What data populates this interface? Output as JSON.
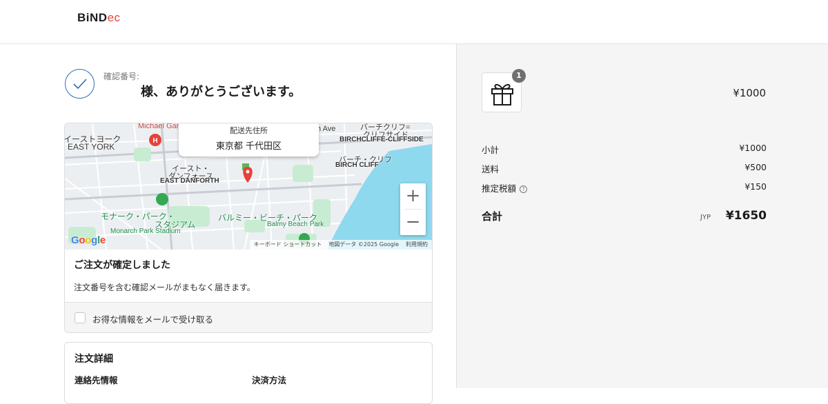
{
  "header": {
    "logo_main": "BiND",
    "logo_accent": "ec"
  },
  "confirmation": {
    "number_label": "確認番号:",
    "thanks": "様、ありがとうございます。"
  },
  "map": {
    "popup_label": "配送先住所",
    "popup_address": "東京都 千代田区",
    "zoom_in": "+",
    "zoom_out": "−",
    "google_logo": "Google",
    "labels": {
      "michael": "Michael Garro",
      "east_york_jp": "イーストヨーク",
      "east_york_en": "EAST YORK",
      "ave": "n Ave",
      "birchcliffe_jp": "バーチクリフ=",
      "birchcliffe_jp2": "クリフサイド",
      "birchcliffe_en": "BIRCHCLIFFE-CLIFFSIDE",
      "birch_cliff_jp": "バーチ・クリフ",
      "birch_cliff_en": "BIRCH CLIFF",
      "east_danforth_jp": "イースト・",
      "east_danforth_jp2": "ダンフォース",
      "east_danforth_en": "EAST DANFORTH",
      "monarch_jp": "モナーク・パーク・",
      "monarch_jp2": "スタジアム",
      "monarch_en": "Monarch Park Stadium",
      "balmy_jp": "バルミー・ビーチ・パーク",
      "balmy_en": "Balmy Beach Park"
    },
    "attribution": {
      "shortcuts": "キーボード ショートカット",
      "data": "地図データ ©2025 Google",
      "terms": "利用規約"
    }
  },
  "order_confirmed": {
    "title": "ご注文が確定しました",
    "text": "注文番号を含む確認メールがまもなく届きます。",
    "optin_label": "お得な情報をメールで受け取る"
  },
  "order_details": {
    "title": "注文詳細",
    "contact_label": "連絡先情報",
    "payment_label": "決済方法"
  },
  "summary": {
    "item_qty": "1",
    "item_icon": "gift-icon",
    "item_price": "¥1000",
    "subtotal_label": "小計",
    "subtotal_value": "¥1000",
    "shipping_label": "送料",
    "shipping_value": "¥500",
    "tax_label": "推定税額",
    "tax_help": "?",
    "tax_value": "¥150",
    "total_label": "合計",
    "total_currency": "JYP",
    "total_value": "¥1650"
  },
  "colors": {
    "accent": "#2a6db3",
    "logo_accent": "#e0453a",
    "water": "#8fd9ef",
    "park": "#c8ecd2",
    "pin": "#e8403a"
  }
}
